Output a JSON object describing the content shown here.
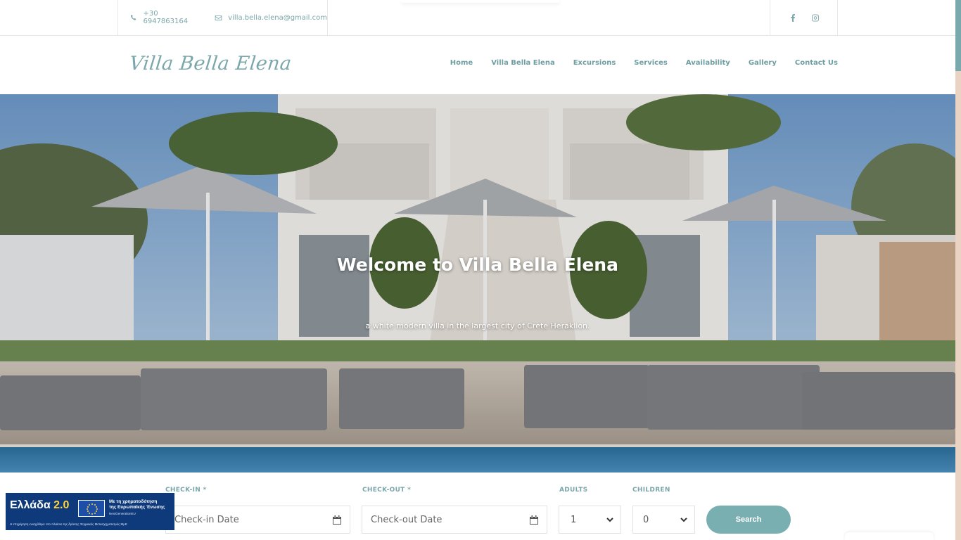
{
  "topbar": {
    "phone": "+30 6947863164",
    "email": "villa.bella.elena@gmail.com",
    "social": [
      "facebook-icon",
      "instagram-icon"
    ]
  },
  "header": {
    "logo": "Villa Bella Elena",
    "nav": [
      "Home",
      "Villa Bella Elena",
      "Excursions",
      "Services",
      "Availability",
      "Gallery",
      "Contact Us"
    ]
  },
  "hero": {
    "title": "Welcome to Villa Bella Elena",
    "subtitle": "a white modern villa in the largest city of Crete Heraklion."
  },
  "booking": {
    "checkin_label": "CHECK-IN",
    "checkin_placeholder": "Check-in Date",
    "checkout_label": "CHECK-OUT",
    "checkout_placeholder": "Check-out Date",
    "required_mark": "*",
    "adults_label": "ADULTS",
    "adults_value": "1",
    "children_label": "CHILDREN",
    "children_value": "0",
    "search_label": "Search"
  },
  "badge": {
    "title": "Ελλάδα",
    "version": "2.0",
    "eu_text_1": "Με τη χρηματοδότηση",
    "eu_text_2": "της Ευρωπαϊκής Ένωσης",
    "eu_small": "NextGenerationEU",
    "footer": "Η επιχείρηση ενισχύθηκε στο πλαίσιο της δράσης Ψηφιακός Μετασχηματισμός ΜμΕ"
  },
  "colors": {
    "accent": "#7ba7ab",
    "button": "#7aafb2",
    "scrollbar_track": "#ead3c3",
    "badge_bg": "#0e3a7c"
  }
}
